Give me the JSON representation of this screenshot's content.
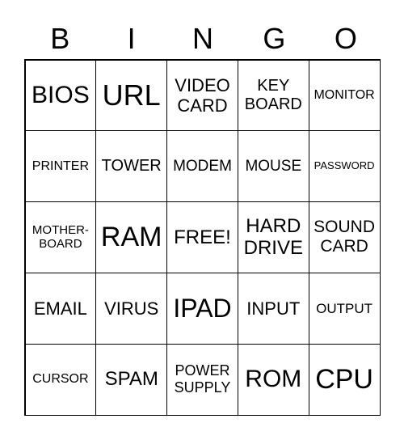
{
  "header": [
    "B",
    "I",
    "N",
    "G",
    "O"
  ],
  "cells": [
    [
      "BIOS",
      "URL",
      "VIDEO CARD",
      "KEY BOARD",
      "MONITOR"
    ],
    [
      "PRINTER",
      "TOWER",
      "MODEM",
      "MOUSE",
      "PASSWORD"
    ],
    [
      "MOTHER-BOARD",
      "RAM",
      "FREE!",
      "HARD DRIVE",
      "SOUND CARD"
    ],
    [
      "EMAIL",
      "VIRUS",
      "IPAD",
      "INPUT",
      "OUTPUT"
    ],
    [
      "CURSOR",
      "SPAM",
      "POWER SUPPLY",
      "ROM",
      "CPU"
    ]
  ]
}
